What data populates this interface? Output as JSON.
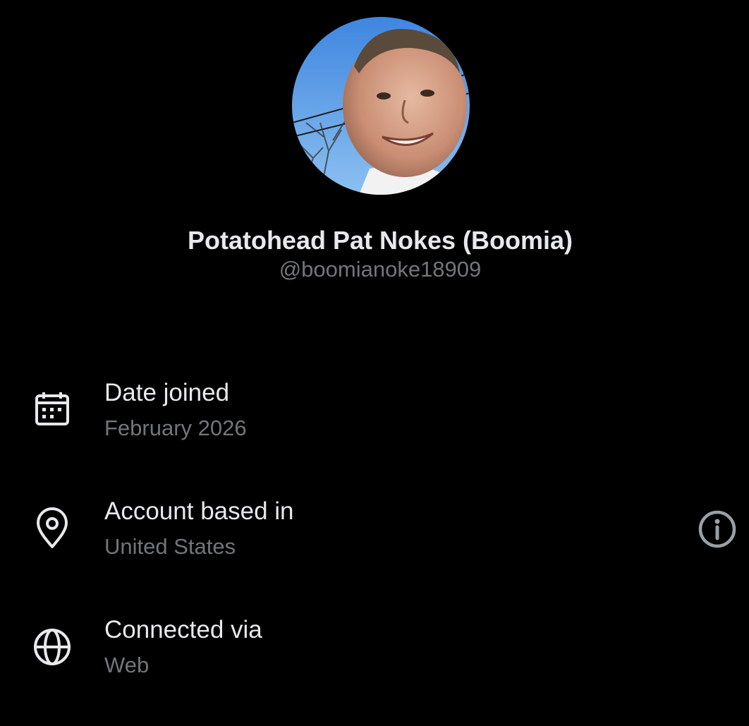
{
  "profile": {
    "display_name": "Potatohead Pat Nokes (Boomia)",
    "handle": "@boomianoke18909"
  },
  "about": {
    "rows": [
      {
        "icon": "calendar-icon",
        "label": "Date joined",
        "value": "February 2026"
      },
      {
        "icon": "location-pin-icon",
        "label": "Account based in",
        "value": "United States"
      },
      {
        "icon": "globe-icon",
        "label": "Connected via",
        "value": "Web"
      }
    ]
  },
  "colors": {
    "background": "#000000",
    "primary_text": "#e7e9ea",
    "secondary_text": "#71767b"
  }
}
